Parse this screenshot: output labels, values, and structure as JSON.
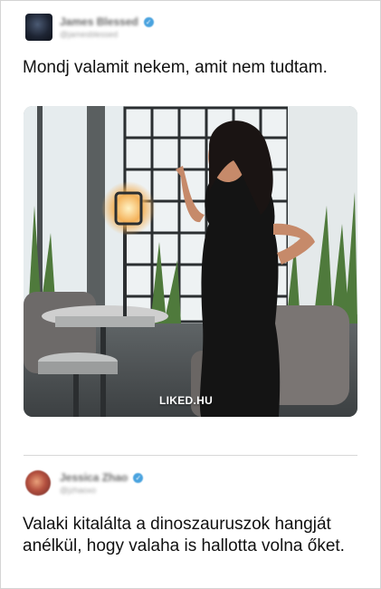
{
  "tweets": [
    {
      "author_name": "James Blessed",
      "author_handle": "@jamesblessed",
      "verified": true,
      "text": "Mondj valamit nekem, amit nem tudtam.",
      "media": {
        "watermark": "LIKED.HU"
      }
    },
    {
      "author_name": "Jessica Zhao",
      "author_handle": "@jzhaoxo",
      "verified": true,
      "text": "Valaki kitalálta a dinoszauruszok hangját anélkül, hogy valaha is hallotta volna őket."
    }
  ],
  "colors": {
    "verified_badge": "#4aa3df",
    "text": "#111111",
    "divider": "#d8d8d8"
  },
  "icons": {
    "verified": "check-badge-icon"
  }
}
